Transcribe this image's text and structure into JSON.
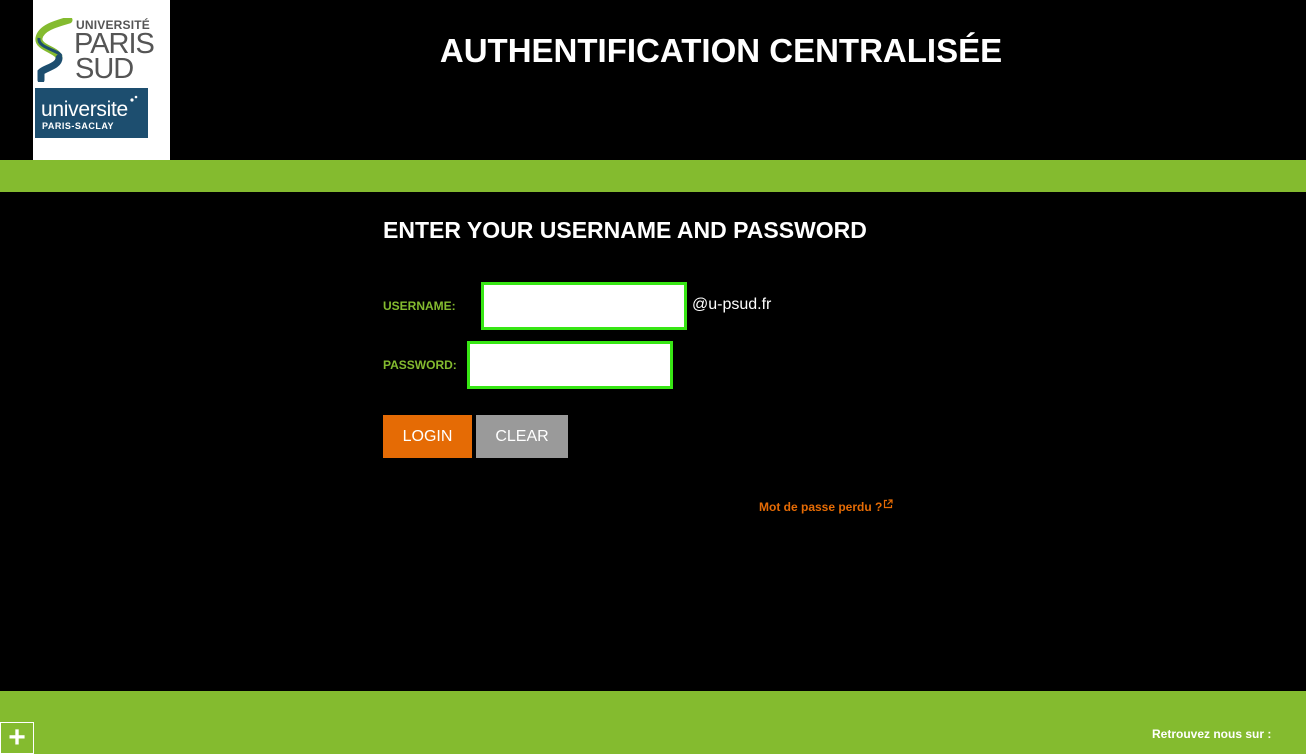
{
  "logo": {
    "ups_university": "UNIVERSITÉ",
    "ups_paris": "PARIS",
    "ups_sud": "SUD",
    "saclay_main": "universite",
    "saclay_sub": "PARIS-SACLAY"
  },
  "header": {
    "title": "AUTHENTIFICATION CENTRALISÉE"
  },
  "form": {
    "heading": "ENTER YOUR USERNAME AND PASSWORD",
    "username_label": "USERNAME:",
    "username_value": "",
    "username_suffix": "@u-psud.fr",
    "password_label": "PASSWORD:",
    "password_value": "",
    "login_label": "LOGIN",
    "clear_label": "CLEAR",
    "lost_password_link": "Mot de passe perdu ?"
  },
  "footer": {
    "plus_symbol": "+",
    "follow_text": "Retrouvez nous sur :"
  },
  "colors": {
    "background": "#000000",
    "accent_green": "#84bb2f",
    "input_border": "#37e614",
    "login_orange": "#e56b05",
    "clear_gray": "#9a9a9a",
    "saclay_blue": "#1d4e6f"
  },
  "icons": {
    "external_link": "external-link-icon",
    "plus": "plus-icon"
  }
}
